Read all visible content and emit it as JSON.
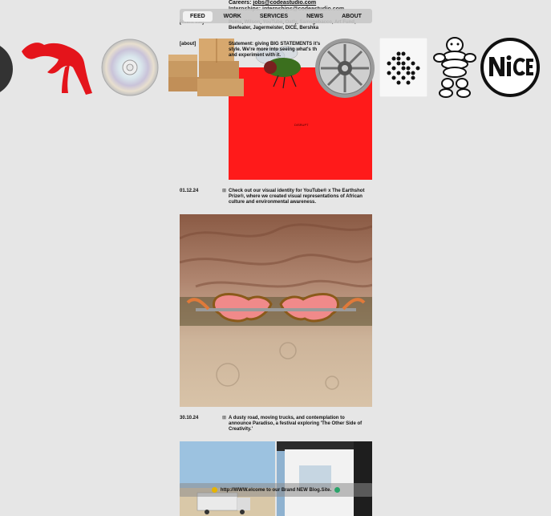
{
  "contact": {
    "careers_label": "Careers:",
    "careers_email": "jobs@codeastudio.com",
    "internships_line": "Internships: internships@codeastudio.com"
  },
  "nav": {
    "tabs": [
      "FEED",
      "WORK",
      "SERVICES",
      "NEWS",
      "ABOUT"
    ],
    "active": "FEED"
  },
  "client_list": {
    "label": "[client list]",
    "text_line1": "Puma, Wilson, YouTube, Oatly, Samsgebacco, Art Fund,",
    "text_line2": "Beefeater, Jagermeister, DICE, Bershka"
  },
  "about": {
    "label": "[about]",
    "text_line1": "Statement: giving BIG STATEMENTS it's",
    "text_line2": "style. We're more into seeing what's th",
    "text_line3": "and experiment with it."
  },
  "icons": [
    "moon-icon",
    "puma-logo-icon",
    "cd-disc-icon",
    "cardboard-boxes-icon",
    "housefly-icon",
    "wheel-rim-icon",
    "dot-pattern-icon",
    "michelin-man-icon",
    "nice-logo-icon"
  ],
  "red_card": {
    "tiny_text": "DISRUPT"
  },
  "posts": [
    {
      "date": "01.12.24",
      "marker": "⊞",
      "text_line1": "Check out our visual identity for YouTube® x The Earthshot",
      "text_line2": "Prize®, where we created visual representations of African",
      "text_line3": "culture and environmental awareness."
    },
    {
      "date": "30.10.24",
      "marker": "⊞",
      "text_line1": "A dusty road, moving trucks, and contemplation to",
      "text_line2": "announce Paradiso, a festival exploring 'The Other Side of",
      "text_line3": "Creativity.'"
    }
  ],
  "banner": {
    "text": "http://WWW.elcome to our Brand NEW Blog.Site."
  },
  "colors": {
    "accent_red": "#ff1a1a",
    "background": "#e6e6e6"
  }
}
